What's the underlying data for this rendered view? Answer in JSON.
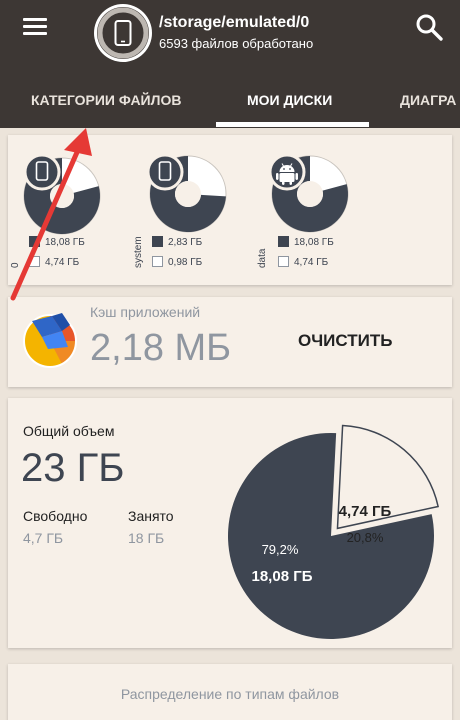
{
  "header": {
    "path": "/storage/emulated/0",
    "processed": "6593 файлов обработано"
  },
  "tabs": [
    {
      "label": "КАТЕГОРИИ ФАЙЛОВ"
    },
    {
      "label": "МОИ ДИСКИ"
    },
    {
      "label": "ДИАГРА"
    }
  ],
  "disks": [
    {
      "label": "0",
      "icon": "phone-icon",
      "used_fraction": 0.792,
      "used": "18,08 ГБ",
      "free": "4,74 ГБ"
    },
    {
      "label": "system",
      "icon": "phone-icon",
      "used_fraction": 0.74,
      "used": "2,83 ГБ",
      "free": "0,98 ГБ"
    },
    {
      "label": "data",
      "icon": "android-icon",
      "used_fraction": 0.792,
      "used": "18,08 ГБ",
      "free": "4,74 ГБ"
    }
  ],
  "cache": {
    "label": "Кэш приложений",
    "size": "2,18 МБ",
    "clear_label": "ОЧИСТИТЬ"
  },
  "volume": {
    "label": "Общий объем",
    "total": "23 ГБ",
    "free_label": "Свободно",
    "free_value": "4,7 ГБ",
    "used_label": "Занято",
    "used_value": "18 ГБ",
    "pie": {
      "free_size": "4,74 ГБ",
      "free_percent": "20,8%",
      "used_percent": "79,2%",
      "used_size": "18,08 ГБ"
    }
  },
  "distribution": {
    "title": "Распределение по типам файлов"
  },
  "colors": {
    "header": "#3d3734",
    "background": "#ece4da",
    "card": "#f7f0e8",
    "used": "#3e4551",
    "free": "#ffffff",
    "arrow": "#e53935"
  },
  "chart_data": {
    "type": "pie",
    "categories": [
      "Свободно",
      "Занято"
    ],
    "values": [
      20.8,
      79.2
    ]
  }
}
